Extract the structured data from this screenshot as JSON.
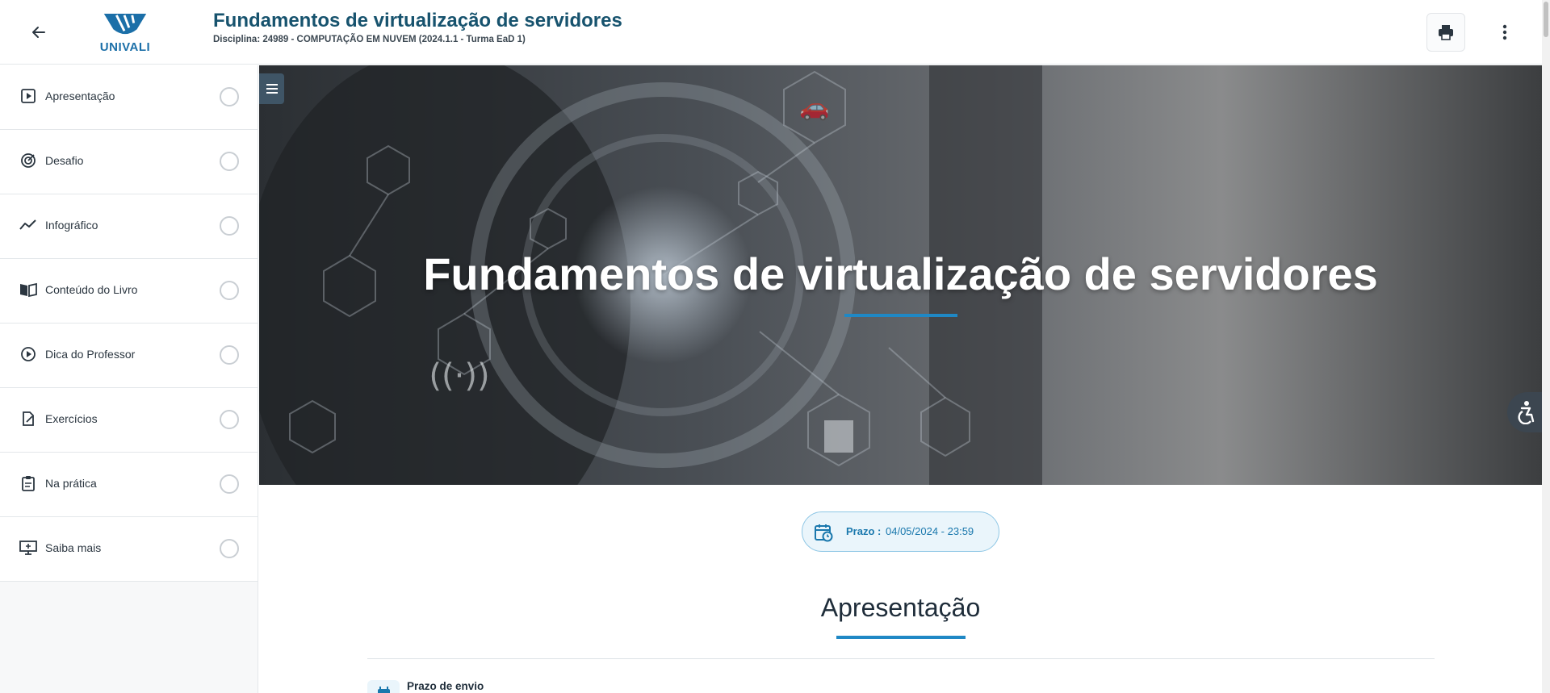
{
  "header": {
    "logo_text": "UNIVALI",
    "title": "Fundamentos de virtualização de servidores",
    "subtitle": "Disciplina: 24989 - COMPUTAÇÃO EM NUVEM (2024.1.1 - Turma EaD 1)",
    "icons": {
      "back": "arrow-left-icon",
      "print": "printer-icon",
      "more": "more-vertical-icon"
    }
  },
  "sidebar": {
    "items": [
      {
        "label": "Apresentação",
        "icon": "play-square-icon"
      },
      {
        "label": "Desafio",
        "icon": "target-icon"
      },
      {
        "label": "Infográfico",
        "icon": "trend-line-icon"
      },
      {
        "label": "Conteúdo do Livro",
        "icon": "book-open-icon"
      },
      {
        "label": "Dica do Professor",
        "icon": "play-circle-icon"
      },
      {
        "label": "Exercícios",
        "icon": "edit-document-icon"
      },
      {
        "label": "Na prática",
        "icon": "clipboard-icon"
      },
      {
        "label": "Saiba mais",
        "icon": "presentation-icon"
      }
    ]
  },
  "hero": {
    "title": "Fundamentos de virtualização de servidores"
  },
  "deadline": {
    "label": "Prazo :",
    "value": "04/05/2024 - 23:59"
  },
  "section": {
    "title": "Apresentação",
    "submit_label": "Prazo de envio"
  },
  "colors": {
    "accent": "#1f88c5",
    "title": "#17536e",
    "deadline_bg": "#eaf5fb"
  }
}
